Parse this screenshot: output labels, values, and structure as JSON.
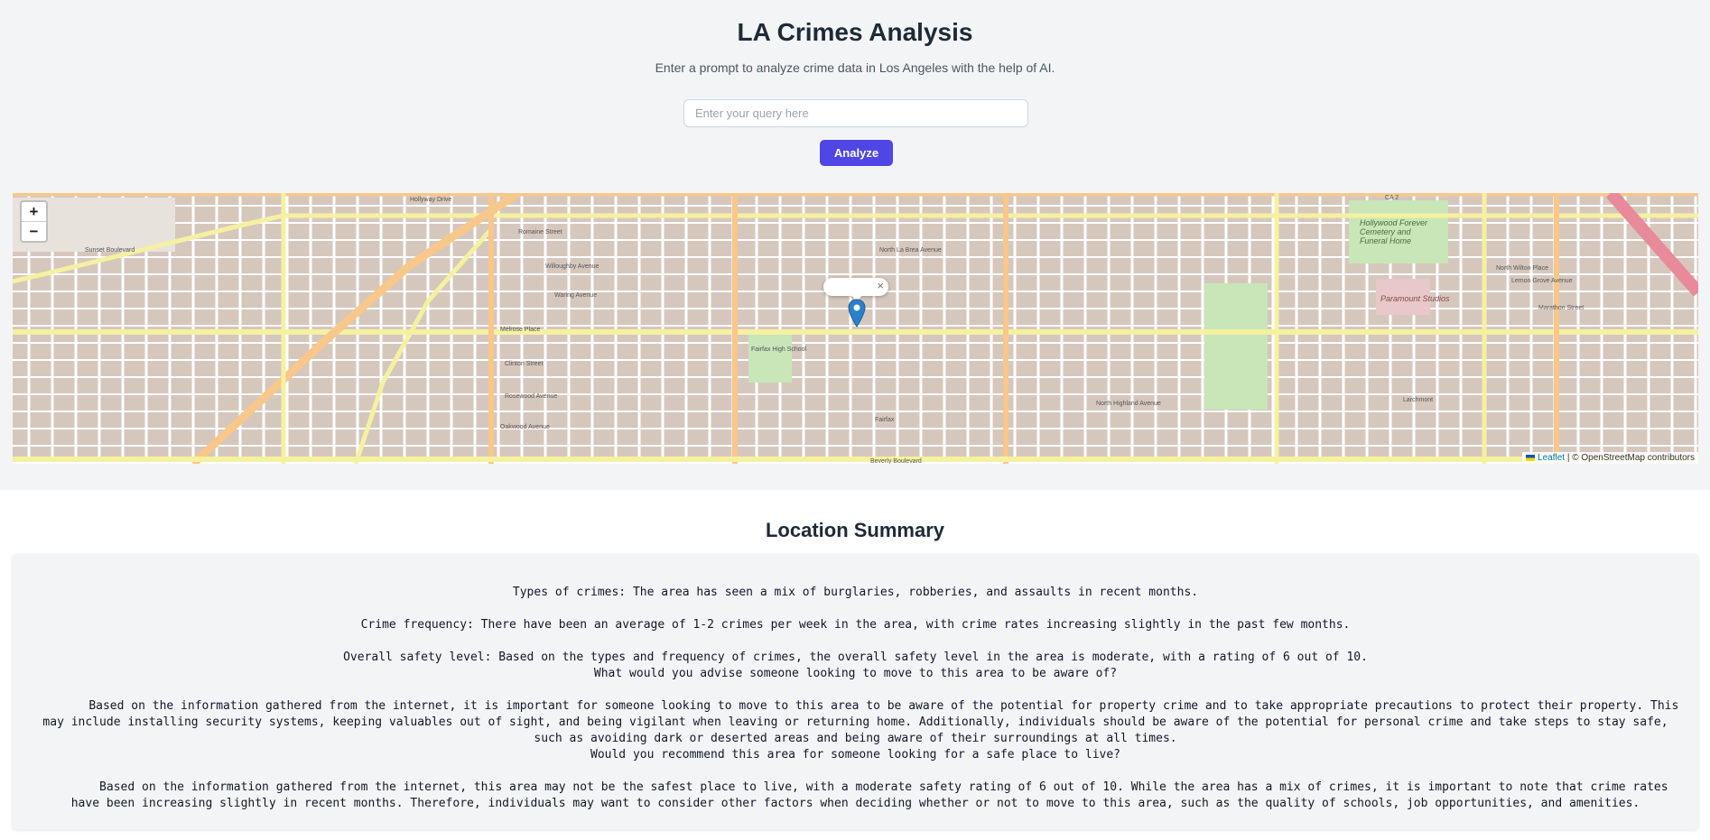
{
  "header": {
    "title": "LA Crimes Analysis",
    "subtitle": "Enter a prompt to analyze crime data in Los Angeles with the help of AI."
  },
  "query": {
    "placeholder": "Enter your query here",
    "value": ""
  },
  "analyze_label": "Analyze",
  "map": {
    "zoom_in": "+",
    "zoom_out": "−",
    "popup_close": "×",
    "attribution_leaflet": "Leaflet",
    "attribution_rest": " | © OpenStreetMap contributors",
    "street_labels": [
      "Sunset Boulevard",
      "Hollyway Drive",
      "Romaine Street",
      "Willoughby Avenue",
      "Waring Avenue",
      "Melrose Place",
      "Clinton Street",
      "Rosewood Avenue",
      "Oakwood Avenue",
      "Beverly Boulevard",
      "North La Brea Avenue",
      "North Highland Avenue",
      "Hollywood Forever Cemetery and Funeral Home",
      "Paramount Studios",
      "Fairfax High School",
      "Fairfax",
      "Larchmont",
      "CA 2",
      "North Wilton Place",
      "Lemon Grove Avenue",
      "Marathon Street"
    ],
    "colors": {
      "major_road": "#f8c78a",
      "secondary_road": "#f5f1a0",
      "blocks": "#d6c7bd",
      "park": "#c8e6b8",
      "marker": "#2a81cb"
    }
  },
  "summary": {
    "title": "Location Summary",
    "paragraphs": [
      "Types of crimes: The area has seen a mix of burglaries, robberies, and assaults in recent months.",
      "",
      "Crime frequency: There have been an average of 1-2 crimes per week in the area, with crime rates increasing slightly in the past few months.",
      "",
      "Overall safety level: Based on the types and frequency of crimes, the overall safety level in the area is moderate, with a rating of 6 out of 10.",
      "What would you advise someone looking to move to this area to be aware of?",
      "",
      "        Based on the information gathered from the internet, it is important for someone looking to move to this area to be aware of the potential for property crime and to take appropriate precautions to protect their property. This may include installing security systems, keeping valuables out of sight, and being vigilant when leaving or returning home. Additionally, individuals should be aware of the potential for personal crime and take steps to stay safe, such as avoiding dark or deserted areas and being aware of their surroundings at all times.",
      "Would you recommend this area for someone looking for a safe place to live?",
      "",
      "        Based on the information gathered from the internet, this area may not be the safest place to live, with a moderate safety rating of 6 out of 10. While the area has a mix of crimes, it is important to note that crime rates have been increasing slightly in recent months. Therefore, individuals may want to consider other factors when deciding whether or not to move to this area, such as the quality of schools, job opportunities, and amenities."
    ]
  }
}
